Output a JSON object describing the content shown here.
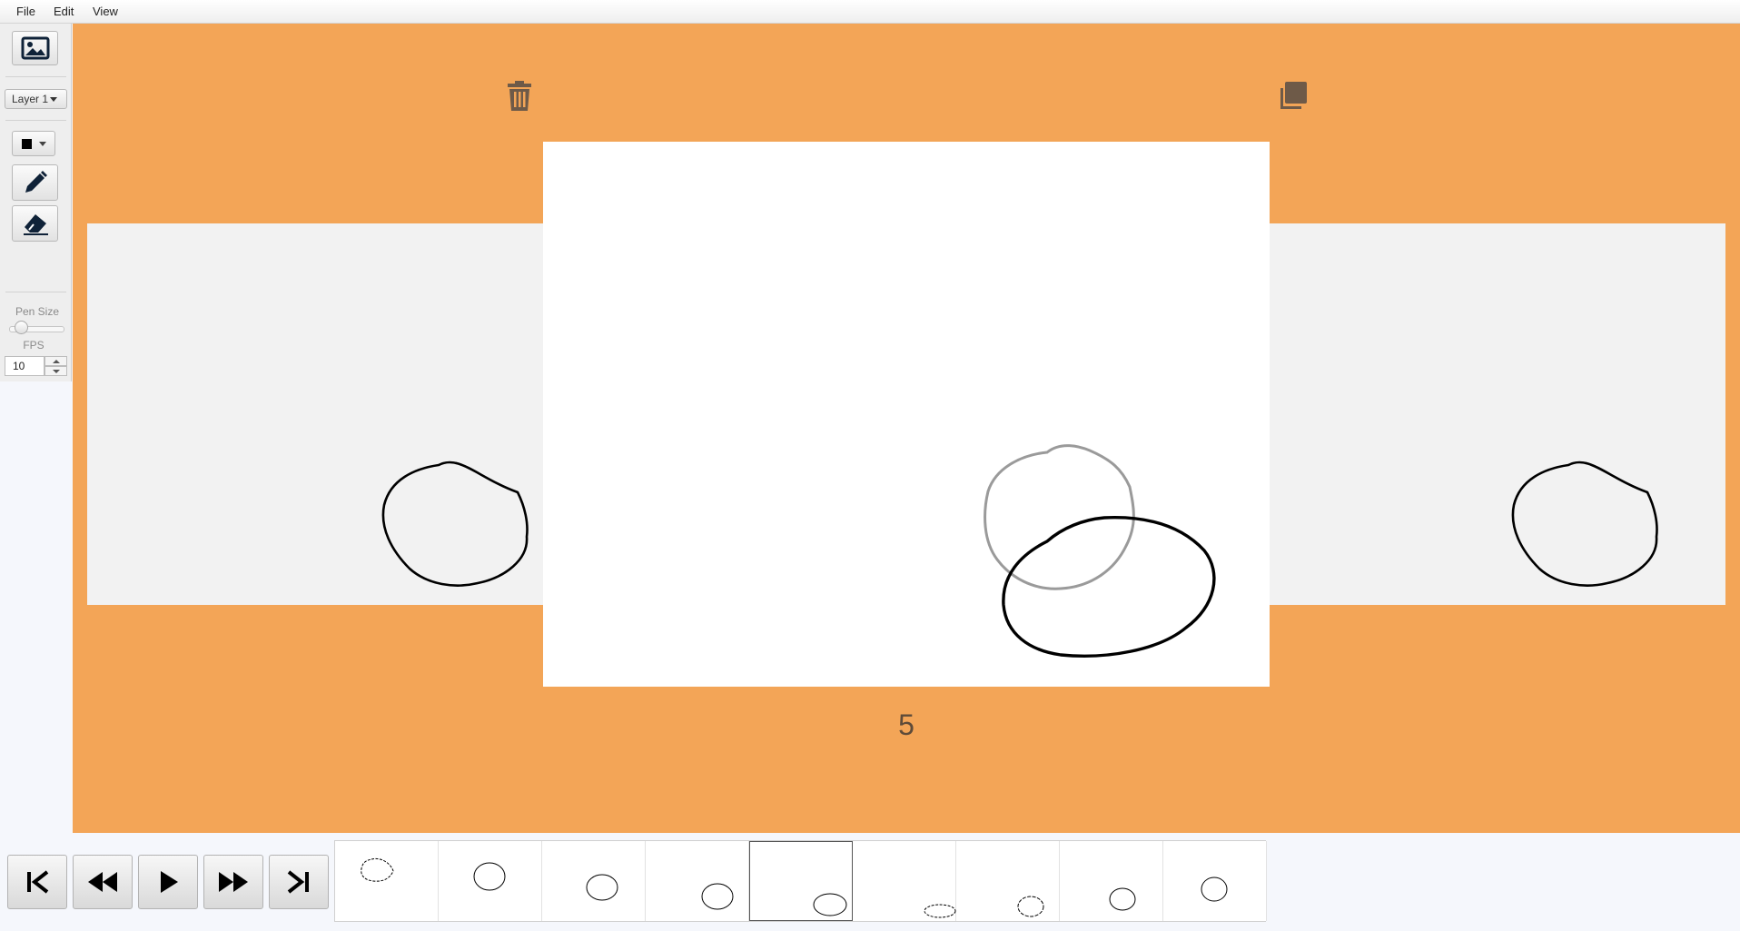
{
  "menu": {
    "file": "File",
    "edit": "Edit",
    "view": "View"
  },
  "toolbar": {
    "layer_select": "Layer 1",
    "pen_size_label": "Pen Size",
    "pen_size_value": 0.1,
    "fps_label": "FPS",
    "fps_value": "10",
    "current_color": "#000000"
  },
  "stage": {
    "background_color": "#f3a557",
    "frame_number": "5",
    "delete_icon": "trash-icon",
    "duplicate_icon": "copy-icon"
  },
  "playback": {
    "buttons": [
      "skip-to-start-icon",
      "rewind-icon",
      "play-icon",
      "fast-forward-icon",
      "skip-to-end-icon"
    ]
  },
  "timeline": {
    "frame_count": 9,
    "active_frame": 5
  }
}
